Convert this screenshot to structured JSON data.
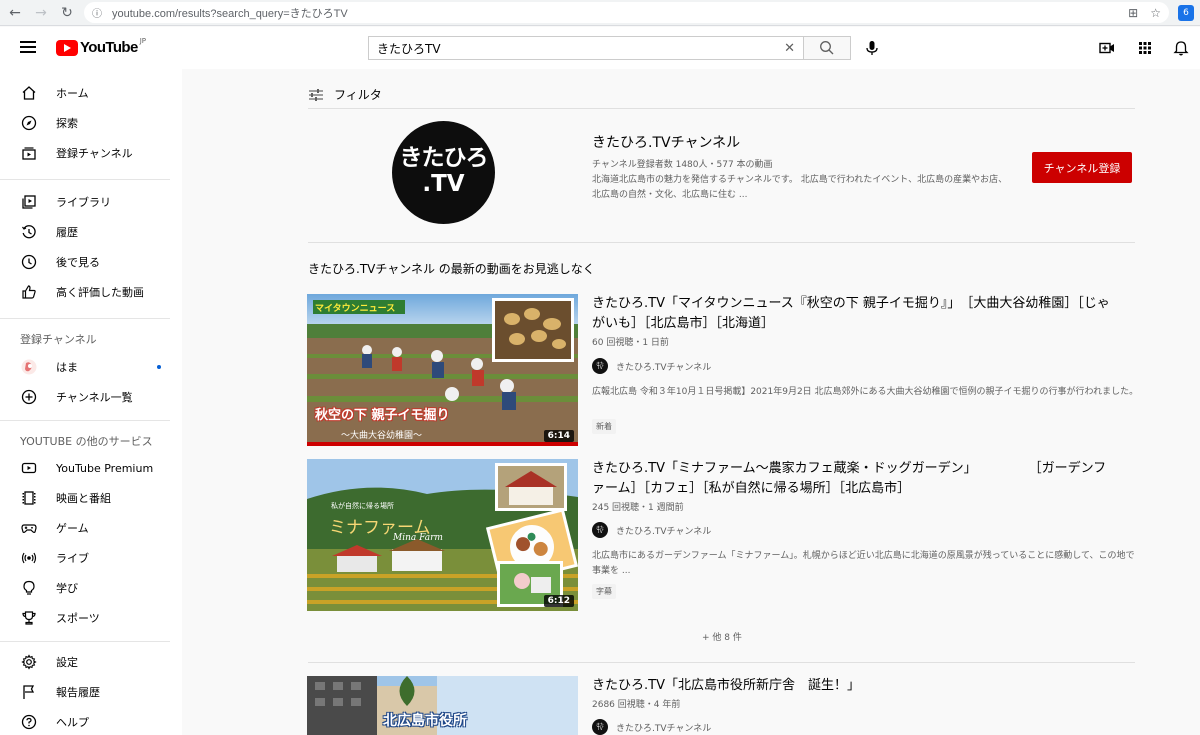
{
  "browser": {
    "url": "youtube.com/results?search_query=きたひろTV"
  },
  "header": {
    "logo_text": "YouTube",
    "logo_region": "JP",
    "search_value": "きたひろTV"
  },
  "sidebar": {
    "main": [
      {
        "label": "ホーム",
        "icon": "home-icon"
      },
      {
        "label": "探索",
        "icon": "compass-icon"
      },
      {
        "label": "登録チャンネル",
        "icon": "subscriptions-icon"
      }
    ],
    "library": [
      {
        "label": "ライブラリ",
        "icon": "library-icon"
      },
      {
        "label": "履歴",
        "icon": "history-icon"
      },
      {
        "label": "後で見る",
        "icon": "clock-icon"
      },
      {
        "label": "高く評価した動画",
        "icon": "thumbs-up-icon"
      }
    ],
    "subscriptions_heading": "登録チャンネル",
    "subscriptions": [
      {
        "label": "はま",
        "icon": "channel-avatar-icon"
      },
      {
        "label": "チャンネル一覧",
        "icon": "plus-circle-icon"
      }
    ],
    "more_heading": "YOUTUBE の他のサービス",
    "more": [
      {
        "label": "YouTube Premium",
        "icon": "youtube-icon"
      },
      {
        "label": "映画と番組",
        "icon": "film-icon"
      },
      {
        "label": "ゲーム",
        "icon": "gamepad-icon"
      },
      {
        "label": "ライブ",
        "icon": "live-icon"
      },
      {
        "label": "学び",
        "icon": "lightbulb-icon"
      },
      {
        "label": "スポーツ",
        "icon": "trophy-icon"
      }
    ],
    "footer": [
      {
        "label": "設定",
        "icon": "gear-icon"
      },
      {
        "label": "報告履歴",
        "icon": "flag-icon"
      },
      {
        "label": "ヘルプ",
        "icon": "help-icon"
      }
    ]
  },
  "main": {
    "filter_label": "フィルタ",
    "channel": {
      "avatar_line1": "きたひろ",
      "avatar_line2": ".TV",
      "name": "きたひろ.TVチャンネル",
      "meta": "チャンネル登録者数 1480人・577 本の動画",
      "description": "北海道北広島市の魅力を発信するチャンネルです。 北広島で行われたイベント、北広島の産業やお店、北広島の自然・文化、北広島に住む ...",
      "subscribe_label": "チャンネル登録"
    },
    "shelf_title": "きたひろ.TVチャンネル の最新の動画をお見逃しなく",
    "videos": [
      {
        "title": "きたひろ.TV「マイタウンニュース『秋空の下 親子イモ掘り』」　［大曲大谷幼稚園］［じゃがいも］［北広島市］［北海道］",
        "meta": "60 回視聴・1 日前",
        "channel": "きたひろ.TVチャンネル",
        "description": "広報北広島 令和３年10月１日号掲載】2021年9月2日 北広島郊外にある大曲大谷幼稚園で恒例の親子イモ掘りの行事が行われました。",
        "badge": "新着",
        "duration": "6:14",
        "thumb_tag": "マイタウンニュース",
        "thumb_caption": "秋空の下 親子イモ掘り",
        "thumb_sub": "～大曲大谷幼稚園～"
      },
      {
        "title": "きたひろ.TV「ミナファーム〜農家カフェ蔵楽・ドッグガーデン」　　　　　［ガーデンファーム］［カフェ］［私が自然に帰る場所］［北広島市］",
        "meta": "245 回視聴・1 週間前",
        "channel": "きたひろ.TVチャンネル",
        "description": "北広島市にあるガーデンファーム「ミナファーム」。札幌からほど近い北広島に北海道の原風景が残っていることに感動して、この地で事業を ...",
        "badge": "字幕",
        "duration": "6:12",
        "thumb_tag": "私が自然に帰る場所",
        "thumb_caption": "ミナファーム",
        "thumb_sub": "Mina Farm"
      },
      {
        "title": "きたひろ.TV「北広島市役所新庁舎　誕生！」",
        "meta": "2686 回視聴・4 年前",
        "channel": "きたひろ.TVチャンネル",
        "thumb_caption": "北広島市役所"
      }
    ],
    "more_label": "+ 他 8 件"
  },
  "colors": {
    "brand_red": "#ff0000",
    "subscribe_red": "#cc0000",
    "text_primary": "#030303",
    "text_secondary": "#606060"
  }
}
